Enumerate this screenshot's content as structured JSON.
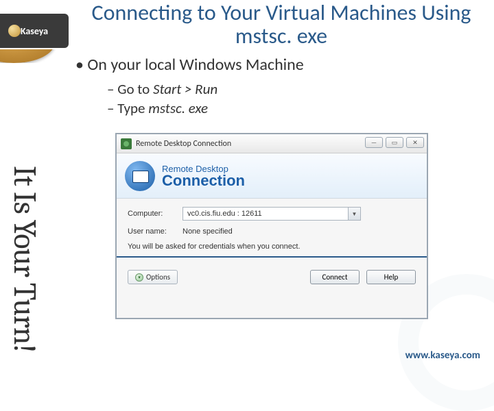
{
  "logo": {
    "brand": "Kaseya"
  },
  "title": "Connecting to Your Virtual Machines Using mstsc. exe",
  "sidebar_text": "It Is Your Turn!",
  "bullets": {
    "b1": "On your local Windows Machine",
    "b2a_prefix": "Go to ",
    "b2a_em": "Start > Run",
    "b2b_prefix": "Type ",
    "b2b_em": "mstsc. exe"
  },
  "rdc": {
    "window_title": "Remote Desktop Connection",
    "banner_line1": "Remote Desktop",
    "banner_line2": "Connection",
    "computer_label": "Computer:",
    "computer_value": "vc0.cis.fiu.edu : 12611",
    "username_label": "User name:",
    "username_value": "None specified",
    "hint": "You will be asked for credentials when you connect.",
    "options": "Options",
    "connect": "Connect",
    "help": "Help"
  },
  "footer_url": "www.kaseya.com"
}
